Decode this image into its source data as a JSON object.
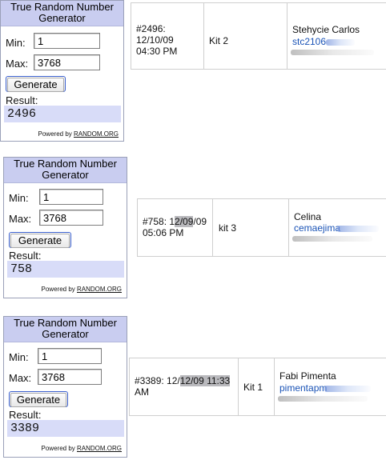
{
  "widget": {
    "title": "True Random Number Generator",
    "min_label": "Min:",
    "max_label": "Max:",
    "generate_label": "Generate",
    "result_label": "Result:",
    "powered_prefix": "Powered by",
    "powered_link": "RANDOM.ORG"
  },
  "draws": [
    {
      "min": "1",
      "max": "3768",
      "result": "2496",
      "record": {
        "id_date": "#2496:",
        "date": "12/10/09",
        "time": "04:30 PM",
        "kit": "Kit 2",
        "name": "Stehycie Carlos",
        "email": "stc2106"
      }
    },
    {
      "min": "1",
      "max": "3768",
      "result": "758",
      "record": {
        "id_prefix": "#758: 1",
        "date_hl": "2/09",
        "date_rest": "/09",
        "time": "05:06 PM",
        "kit": "kit 3",
        "name": "Celina",
        "email": "cemaejima"
      }
    },
    {
      "min": "1",
      "max": "3768",
      "result": "3389",
      "record": {
        "id_prefix": "#3389: 12/",
        "date_hl": "12/09 11:33",
        "time": "AM",
        "kit": "Kit 1",
        "name": "Fabi Pimenta",
        "email": "pimentapm"
      }
    }
  ]
}
